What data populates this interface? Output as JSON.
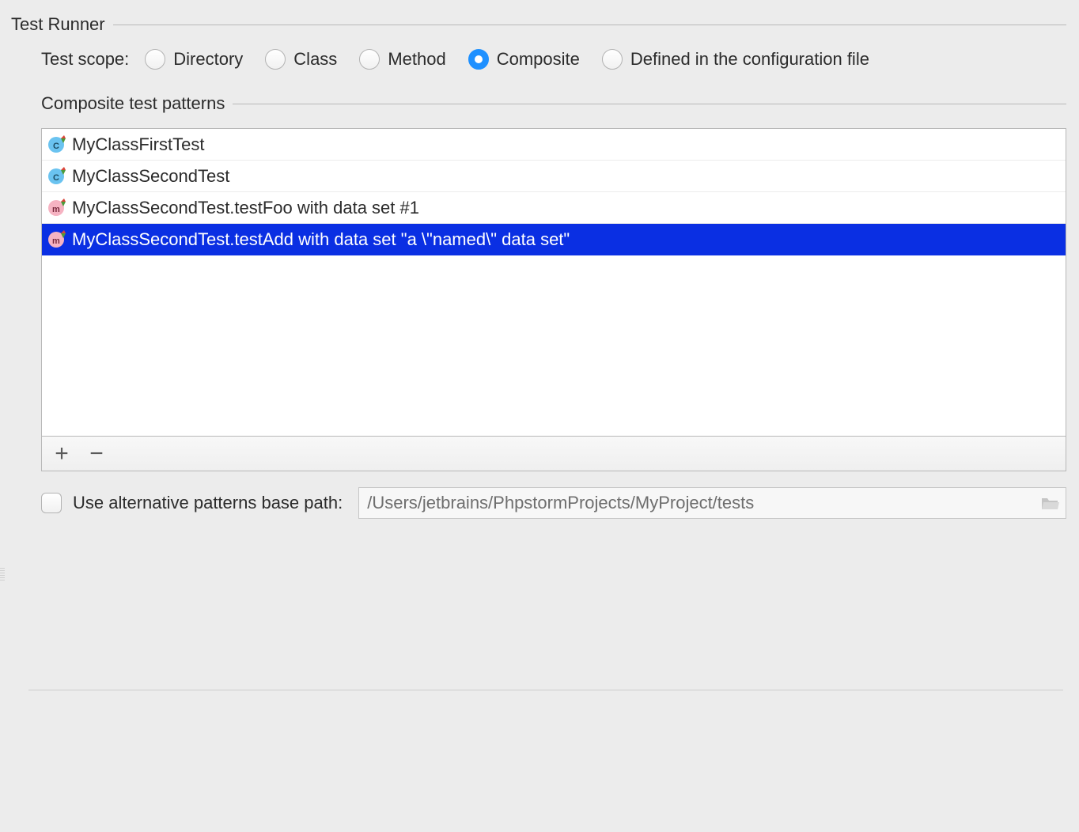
{
  "section_title": "Test Runner",
  "scope": {
    "label": "Test scope:",
    "selected": "Composite",
    "options": [
      {
        "label": "Directory"
      },
      {
        "label": "Class"
      },
      {
        "label": "Method"
      },
      {
        "label": "Composite"
      },
      {
        "label": "Defined in the configuration file"
      }
    ]
  },
  "patterns": {
    "label": "Composite test patterns",
    "selected_index": 3,
    "items": [
      {
        "icon": "class",
        "text": "MyClassFirstTest"
      },
      {
        "icon": "class",
        "text": "MyClassSecondTest"
      },
      {
        "icon": "method",
        "text": "MyClassSecondTest.testFoo with data set #1"
      },
      {
        "icon": "method",
        "text": "MyClassSecondTest.testAdd with data set \"a \\\"named\\\" data set\""
      }
    ]
  },
  "alt_path": {
    "checkbox_label": "Use alternative patterns base path:",
    "checked": false,
    "value": "/Users/jetbrains/PhpstormProjects/MyProject/tests"
  },
  "toolbar": {
    "add_tooltip": "Add",
    "remove_tooltip": "Remove"
  }
}
